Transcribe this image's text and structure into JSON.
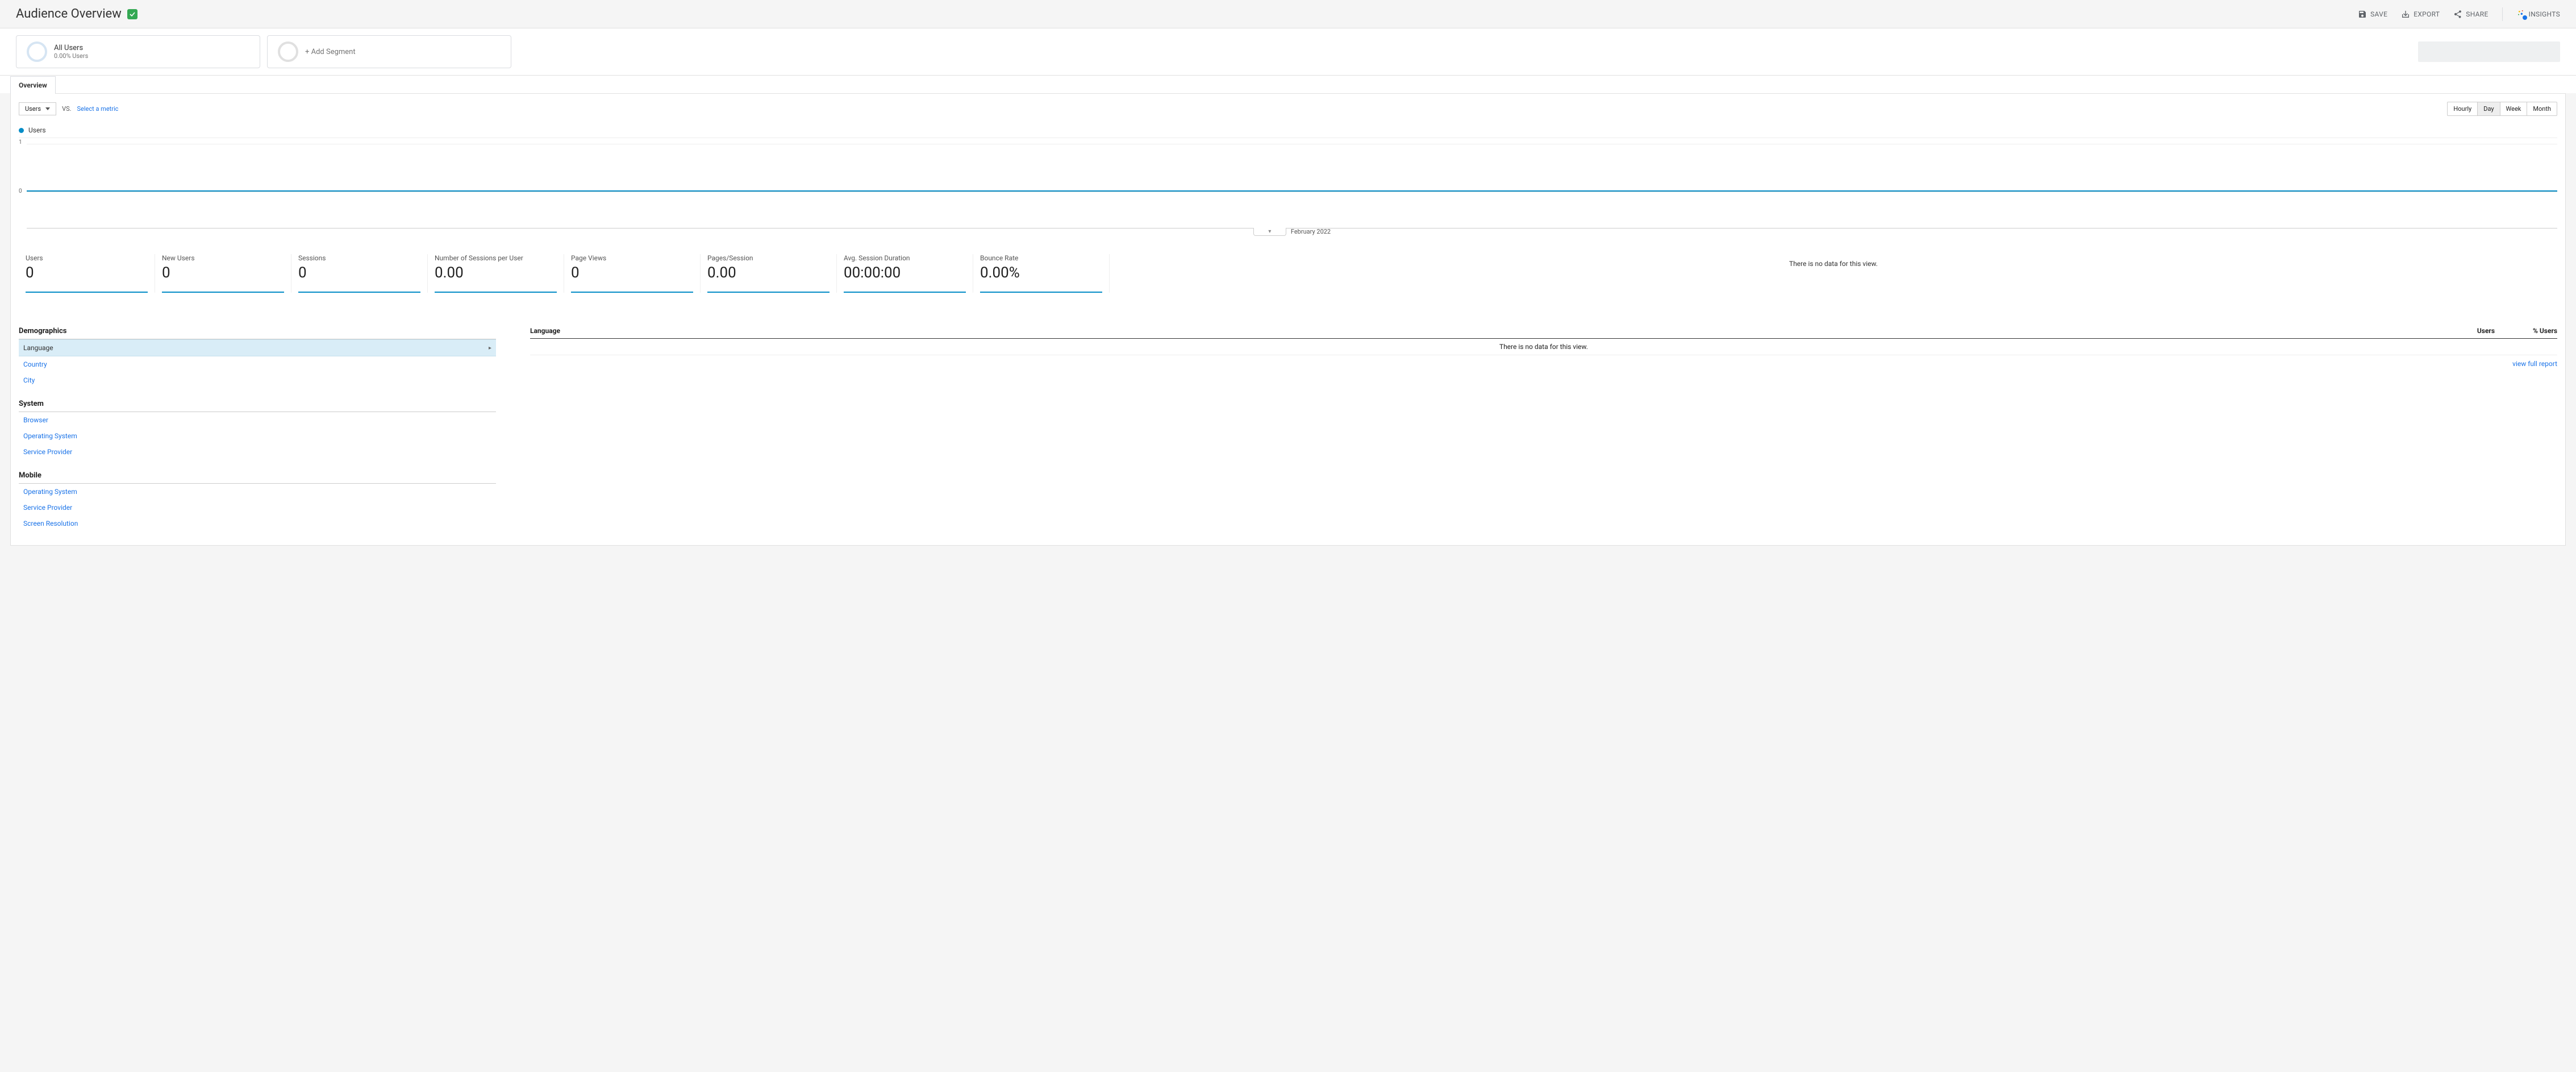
{
  "header": {
    "title": "Audience Overview",
    "actions": {
      "save": "SAVE",
      "export": "EXPORT",
      "share": "SHARE",
      "insights": "INSIGHTS"
    }
  },
  "segments": {
    "primary": {
      "title": "All Users",
      "sub": "0.00% Users"
    },
    "add_label": "+ Add Segment"
  },
  "tabs": {
    "overview": "Overview"
  },
  "metric_selector": {
    "primary": "Users",
    "vs": "VS.",
    "select_link": "Select a metric"
  },
  "granularity": {
    "hourly": "Hourly",
    "day": "Day",
    "week": "Week",
    "month": "Month",
    "active": "Day"
  },
  "chart_data": {
    "type": "line",
    "legend": "Users",
    "y_ticks": [
      "1",
      "0"
    ],
    "x_label": "February 2022",
    "series": [
      {
        "name": "Users",
        "values_constant": 0
      }
    ],
    "ylim": [
      0,
      1
    ]
  },
  "metrics": [
    {
      "label": "Users",
      "value": "0"
    },
    {
      "label": "New Users",
      "value": "0"
    },
    {
      "label": "Sessions",
      "value": "0"
    },
    {
      "label": "Number of Sessions per User",
      "value": "0.00"
    },
    {
      "label": "Page Views",
      "value": "0"
    },
    {
      "label": "Pages/Session",
      "value": "0.00"
    },
    {
      "label": "Avg. Session Duration",
      "value": "00:00:00"
    },
    {
      "label": "Bounce Rate",
      "value": "0.00%"
    }
  ],
  "no_data_msg": "There is no data for this view.",
  "dimensions": {
    "demographics": {
      "title": "Demographics",
      "items": [
        "Language",
        "Country",
        "City"
      ],
      "active": "Language"
    },
    "system": {
      "title": "System",
      "items": [
        "Browser",
        "Operating System",
        "Service Provider"
      ]
    },
    "mobile": {
      "title": "Mobile",
      "items": [
        "Operating System",
        "Service Provider",
        "Screen Resolution"
      ]
    }
  },
  "table": {
    "h_lang": "Language",
    "h_users": "Users",
    "h_pct": "% Users",
    "nodata": "There is no data for this view.",
    "view_full": "view full report"
  }
}
